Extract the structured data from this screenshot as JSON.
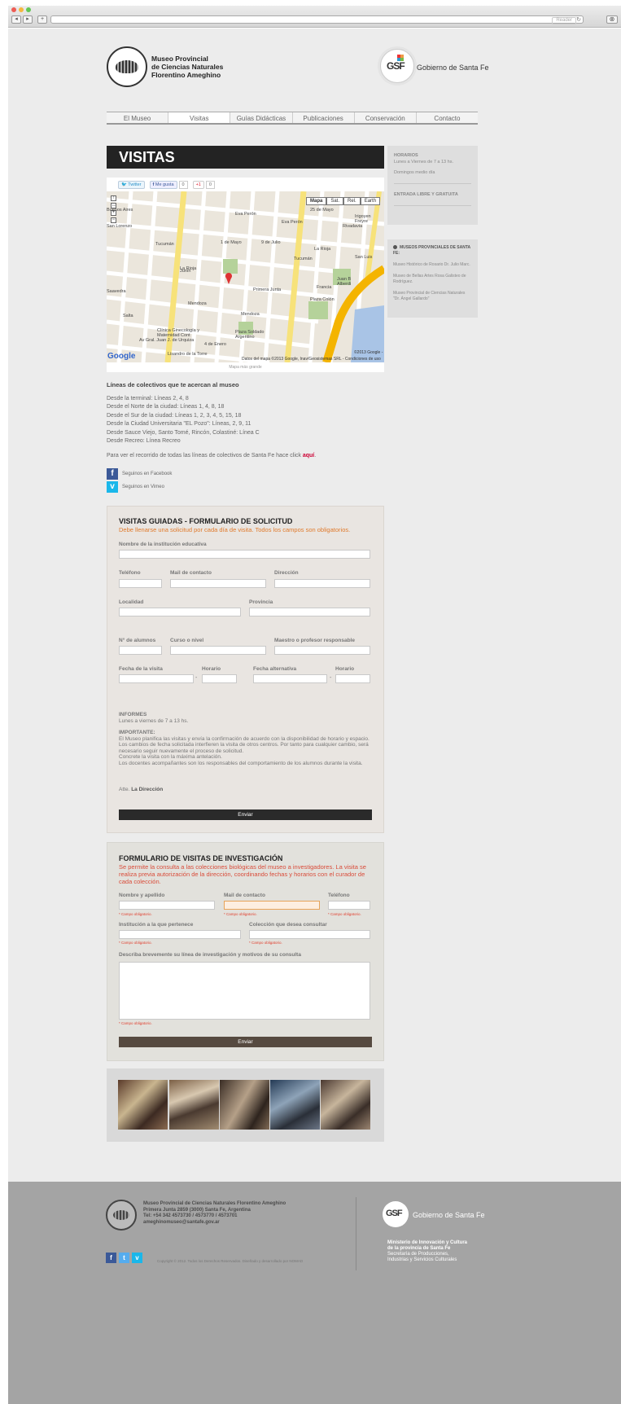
{
  "browser": {
    "reader_label": "Reader"
  },
  "header": {
    "museum_name": [
      "Museo Provincial",
      "de Ciencias Naturales",
      "Florentino Ameghino"
    ],
    "gov_logo_text": "GSF",
    "gov_name": "Gobierno de Santa Fe"
  },
  "nav": {
    "items": [
      "El Museo",
      "Visitas",
      "Guías Didácticas",
      "Publicaciones",
      "Conservación",
      "Contacto"
    ],
    "active": "Visitas"
  },
  "page_title": "VISITAS",
  "sidebar": {
    "horarios_title": "HORARIOS",
    "horarios_line1": "Lunes a Viernes de 7 a 13 hs.",
    "horarios_line2": "Domingos medio día",
    "entrada": "ENTRADA LIBRE Y GRATUITA",
    "museos_title": "MUSEOS PROVINCIALES DE SANTA FE:",
    "museos": [
      "Museo Histórico de Rosario Dr. Julio Marc.",
      "Museo de Bellas Artes Rosa Galisteo de Rodríguez.",
      "Museo Provincial de Ciencias Naturales \"Dr. Ángel Gallardo\""
    ]
  },
  "social": {
    "twitter": "Twitter",
    "facebook": "Me gusta",
    "facebook_count": "0",
    "gplus": "+1",
    "gplus_count": "0"
  },
  "map": {
    "types": [
      "Mapa",
      "Sat.",
      "Rel.",
      "Earth"
    ],
    "google": "Google",
    "copyright": "©2013 Google -",
    "credit": "Datos del mapa ©2013 Google, Inav/Geosistemas SRL - Condiciones de uso",
    "link": "Mapa más grande",
    "labels": [
      "Eva Perón",
      "Eva Perón",
      "Tucumán",
      "Tucumán",
      "Primera Junta",
      "La Rioja",
      "La Rioja",
      "Mendoza",
      "Mendoza",
      "Salta",
      "Lisandro de la Torre",
      "Plaza Colón",
      "Plaza Soldado Argentino",
      "Clínica Ginecología y Maternidad Cont",
      "Juan B Alberdi",
      "San Lorenzo",
      "Saavedra",
      "Francia",
      "Av Gral. Juan J. de Urquiza",
      "4 de Enero",
      "1 de Mayo",
      "9 de Julio",
      "25 de Mayo",
      "Rivadavia",
      "Irigoyen Freyre",
      "San Luis",
      "Junín",
      "Buenos Aires"
    ]
  },
  "lineas": {
    "title": "Líneas de colectivos que te acercan al museo",
    "items": [
      "Desde la terminal: Líneas 2, 4, 8",
      "Desde el Norte de la ciudad: Líneas 1, 4, 8, 18",
      "Desde el Sur de la ciudad: Líneas 1, 2, 3, 4, 5, 15, 18",
      "Desde la Ciudad Universitaria \"EL Pozo\": Líneas, 2, 9, 11",
      "Desde Sauce Viejo, Santo Tomé, Rincón, Colastiné: Línea C",
      "Desde Recreo: Línea Recreo"
    ],
    "ver_text": "Para ver el recorrido de todas las líneas de colectivos de Santa Fe hace click",
    "ver_link": "aquí"
  },
  "follow": {
    "facebook": "Seguinos en Facebook",
    "vimeo": "Seguinos en Vimeo"
  },
  "form1": {
    "title": "VISITAS GUIADAS - FORMULARIO DE SOLICITUD",
    "subtitle": "Debe llenarse una solicitud por cada día de visita. Todos los campos son obligatorios.",
    "labels": {
      "institucion": "Nombre de la institución educativa",
      "telefono": "Teléfono",
      "mail": "Mail de contacto",
      "direccion": "Dirección",
      "localidad": "Localidad",
      "provincia": "Provincia",
      "alumnos": "N° de alumnos",
      "curso": "Curso o nivel",
      "maestro": "Maestro o profesor responsable",
      "fecha": "Fecha de la visita",
      "horario": "Horario",
      "fecha_alt": "Fecha alternativa",
      "horario_alt": "Horario"
    },
    "informes_title": "INFORMES",
    "informes_text": "Lunes a viernes de 7 a 13 hs.",
    "importante_title": "IMPORTANTE:",
    "importante_lines": [
      "El Museo planifica las visitas y envía la confirmación de acuerdo con la disponibilidad de horario y espacio.",
      "Los cambios de fecha solicitada interfieren la visita de otros centros. Por tanto para cualquier cambio, será necesario seguir nuevamente el proceso de solicitud.",
      "Concrete la visita con la máxima antelación.",
      "Los docentes acompañantes son los responsables del comportamiento de los alumnos durante la visita."
    ],
    "atte": "Atte.",
    "direccion_sign": "La Dirección",
    "submit": "Enviar"
  },
  "form2": {
    "title": "FORMULARIO DE VISITAS DE INVESTIGACIÓN",
    "subtitle": "Se permite la consulta a las colecciones biológicas del museo a investigadores. La visita se realiza previa autorización de la dirección, coordinando fechas y horarios con el curador de cada colección.",
    "labels": {
      "nombre": "Nombre y apellido",
      "mail": "Mail de contacto",
      "telefono": "Teléfono",
      "institucion": "Institución a la que pertenece",
      "coleccion": "Colección que desea consultar",
      "describa": "Describa brevemente su línea de investigación y motivos de su consulta"
    },
    "required": "* Campo obligatorio.",
    "submit": "Enviar"
  },
  "footer": {
    "address_lines": [
      "Museo Provincial de Ciencias Naturales Florentino Ameghino",
      "Primera Junta 2859 (3000) Santa Fe, Argentina",
      "Tel: +54 342 4573730 / 4573770 / 4573701",
      "ameghinomuseo@santafe.gov.ar"
    ],
    "gov_logo_text": "GSF",
    "gov_name": "Gobierno de Santa Fe",
    "ministerio_lines": [
      "Ministerio de Innovación y Cultura",
      "de la provincia de Santa Fe"
    ],
    "secretaria_lines": [
      "Secretaría de Producciones,",
      "Industrias y Servicios Culturales"
    ],
    "copyright": "Copyright © 2012. Todos los Derechos Reservados. Diseñado y desarrollado por NOMAD"
  },
  "colors": {
    "title_bar": "#232323",
    "accent_orange": "#e07a2c",
    "accent_red": "#d94c3a",
    "link_red": "#cc0033",
    "facebook": "#3b5998",
    "vimeo": "#1ab7ea",
    "twitter": "#55acee"
  }
}
